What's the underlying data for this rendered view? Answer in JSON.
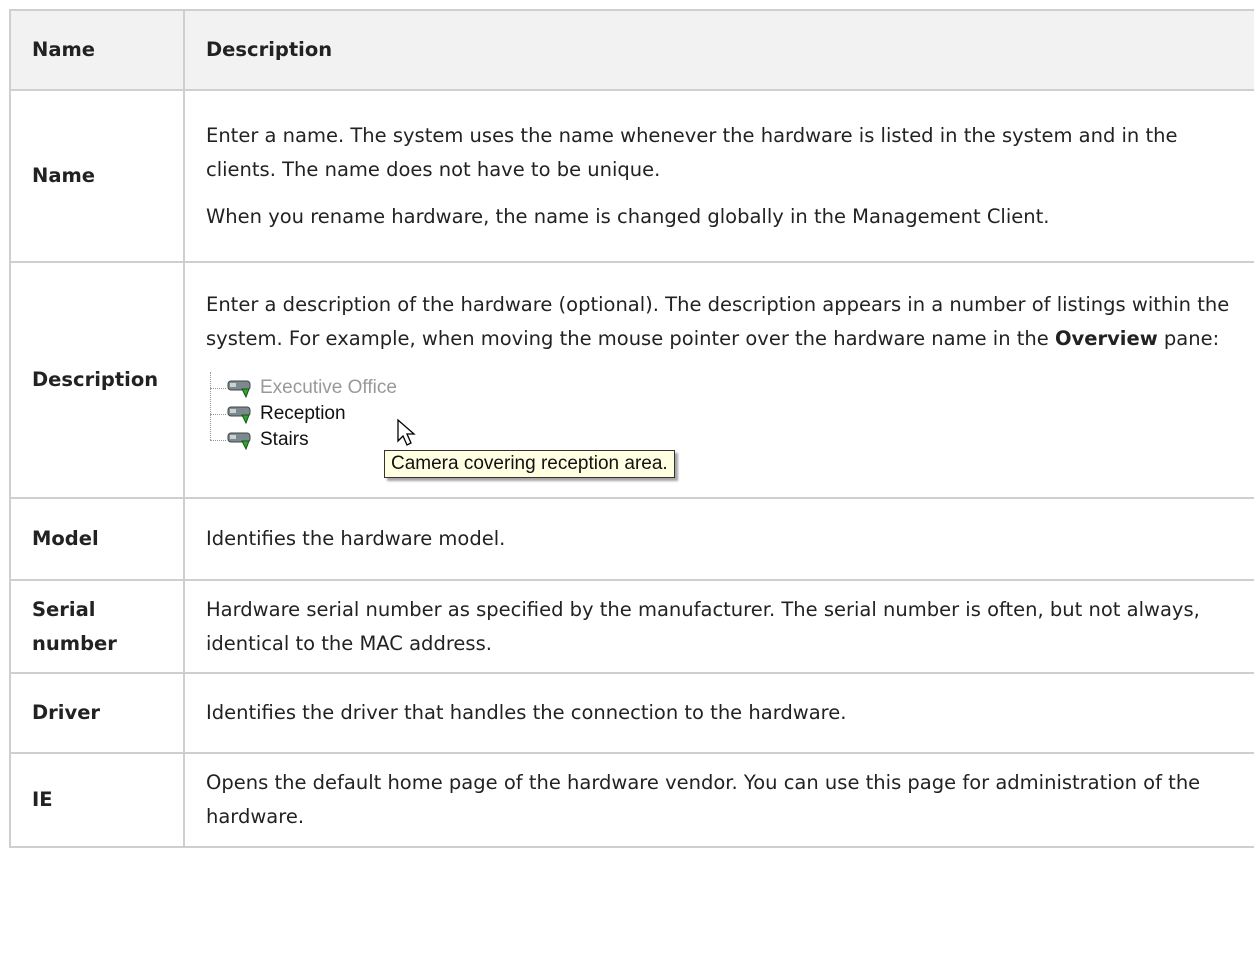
{
  "table": {
    "header": {
      "col1": "Name",
      "col2": "Description"
    },
    "rows": [
      {
        "name": "Name",
        "p1": "Enter a name. The system uses the name whenever the hardware is listed in the system and in the clients. The name does not have to be unique.",
        "p2": "When you rename hardware, the name is changed globally in the Management Client."
      },
      {
        "name": "Description",
        "p1_before": "Enter a description of the hardware (optional). The description appears in a number of listings within the system. For example, when moving the mouse pointer over the hardware name in the ",
        "p1_bold": "Overview",
        "p1_after": " pane:",
        "screenshot": {
          "items": [
            "Executive Office",
            "Reception",
            "Stairs"
          ],
          "tooltip": "Camera covering reception area."
        }
      },
      {
        "name": "Model",
        "desc": "Identifies the hardware model."
      },
      {
        "name": "Serial number",
        "desc": "Hardware serial number as specified by the manufacturer. The serial number is often, but not always, identical to the MAC address."
      },
      {
        "name": "Driver",
        "desc": "Identifies the driver that handles the connection to the hardware."
      },
      {
        "name": "IE",
        "desc": "Opens the default home page of the hardware vendor. You can use this page for administration of the hardware."
      }
    ]
  },
  "icons": {
    "camera": "camera-icon",
    "cursor": "mouse-pointer-icon"
  }
}
